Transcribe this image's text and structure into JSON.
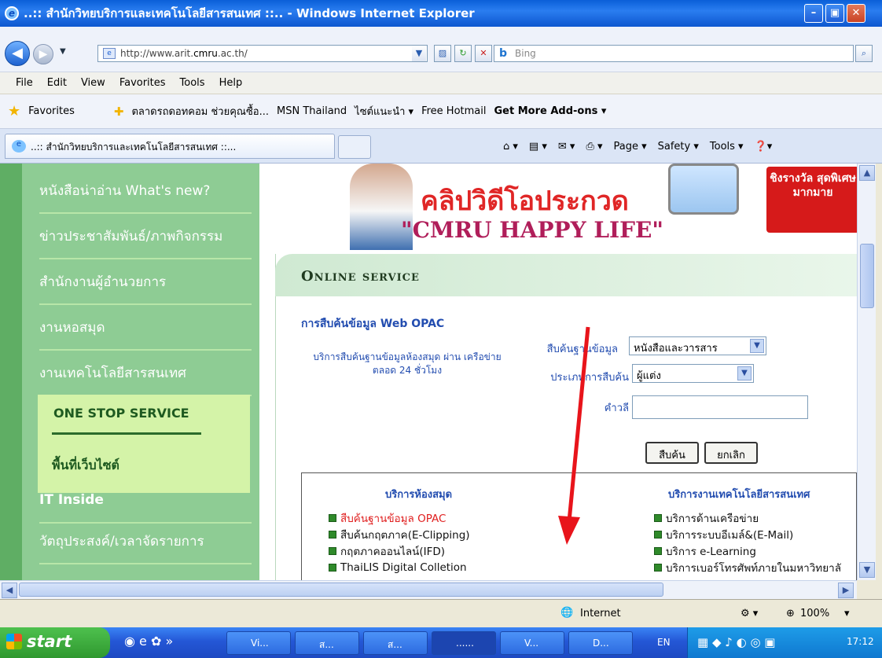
{
  "window": {
    "title": "..:: สำนักวิทยบริการและเทคโนโลยีสารสนเทศ ::.. - Windows Internet Explorer"
  },
  "address": {
    "url_prefix": "http://www.arit.",
    "url_domain": "cmru",
    "url_suffix": ".ac.th/",
    "search_placeholder": "Bing"
  },
  "menu": [
    "File",
    "Edit",
    "View",
    "Favorites",
    "Tools",
    "Help"
  ],
  "favorites": {
    "label": "Favorites",
    "items": [
      "ตลาดรถดอทคอม ช่วยคุณซื้อ...",
      "MSN Thailand",
      "ไซต์แนะนำ ▾",
      "Free Hotmail",
      "Get More Add-ons ▾"
    ]
  },
  "tab": {
    "title": "..:: สำนักวิทยบริการและเทคโนโลยีสารสนเทศ ::..."
  },
  "commandbar": {
    "page": "Page ▾",
    "safety": "Safety ▾",
    "tools": "Tools ▾"
  },
  "leftnav": [
    "หนังสือน่าอ่าน What's new?",
    "ข่าวประชาสัมพันธ์/ภาพกิจกรรม",
    "สำนักงานผู้อำนวยการ",
    "งานหอสมุด",
    "งานเทคโนโลยีสารสนเทศ"
  ],
  "onestop": {
    "title": "ONE STOP SERVICE",
    "sub": "พื้นที่เว็บไซต์"
  },
  "leftnav2": [
    "IT Inside",
    "วัตถุประสงค์/เวลาจัดรายการ"
  ],
  "banner": {
    "title": "คลิปวิดีโอประกวด",
    "subtitle": "\"CMRU HAPPY LIFE\"",
    "prize": "ชิงรางวัล สุดพิเศษ มากมาย"
  },
  "online": {
    "heading": "Online service",
    "opac_title": "การสืบค้นข้อมูล Web OPAC",
    "opac_desc": "บริการสืบค้นฐานข้อมูลห้องสมุด ผ่าน เครือข่าย ตลอด 24 ชั่วโมง",
    "db_label": "สืบค้นฐานข้อมูล",
    "db_value": "หนังสือและวารสาร",
    "type_label": "ประเภทการสืบค้น",
    "type_value": "ผู้แต่ง",
    "keyword_label": "คำวลี",
    "keyword_value": "",
    "search_btn": "สืบค้น",
    "cancel_btn": "ยกเลิก"
  },
  "library": {
    "heading": "บริการห้องสมุด",
    "items": [
      "สืบค้นฐานข้อมูล OPAC",
      "สืบค้นกฤตภาค(E-Clipping)",
      "กฤตภาคออนไลน์(IFD)",
      "ThaiLIS Digital Colletion"
    ]
  },
  "itservice": {
    "heading": "บริการงานเทคโนโลยีสารสนเทศ",
    "items": [
      "บริการด้านเครือข่าย",
      "บริการระบบอีเมล์&(E-Mail)",
      "บริการ e-Learning",
      "บริการเบอร์โทรศัพท์ภายในมหาวิทยาลั"
    ]
  },
  "status": {
    "zone": "Internet",
    "zoom": "100%"
  },
  "taskbar": {
    "start": "start",
    "tasks": [
      "Vi...",
      "ส...",
      "ส...",
      "......",
      "V...",
      "D..."
    ],
    "lang": "EN",
    "time": "17:12"
  },
  "colors": {
    "accent_green": "#8ecc94",
    "link_blue": "#234db0",
    "arrow_red": "#e8141b"
  }
}
